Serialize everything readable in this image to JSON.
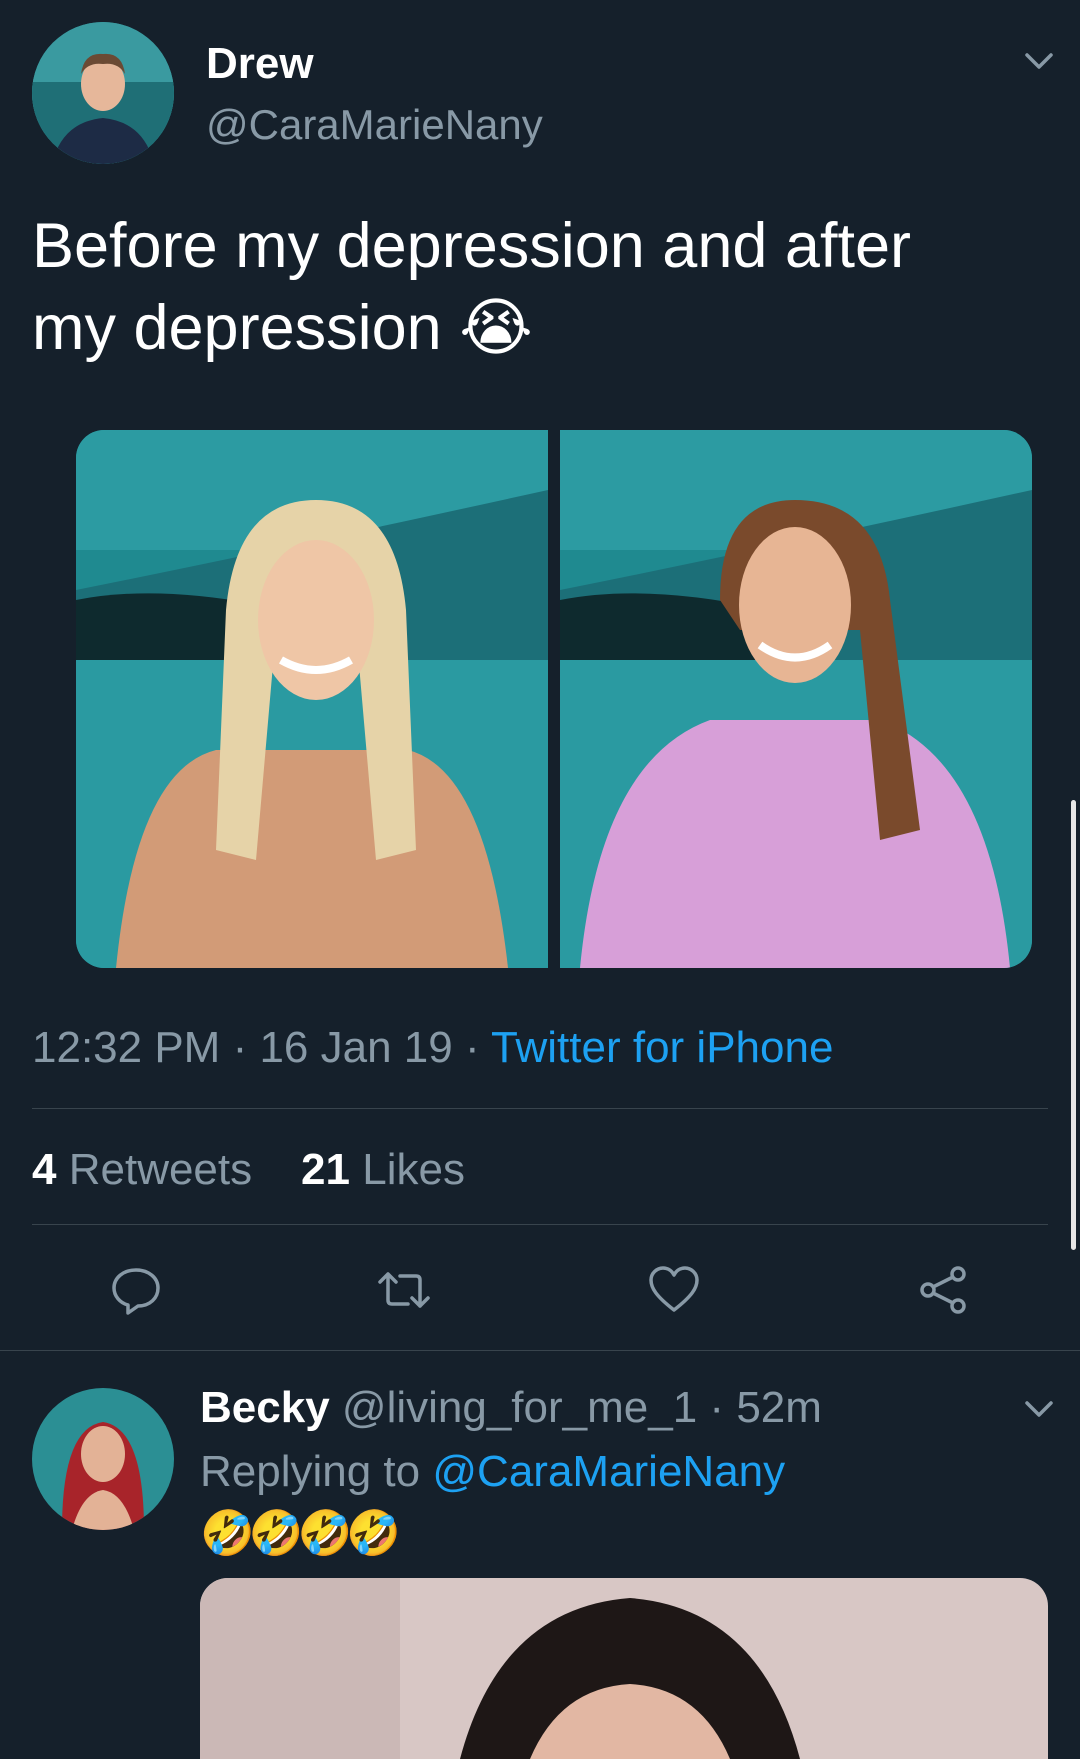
{
  "tweet": {
    "author_name": "Drew",
    "author_handle": "@CaraMarieNany",
    "text_line1": "Before my depression and after",
    "text_line2": "my depression",
    "emoji": "😭",
    "time": "12:32 PM",
    "sep1": " · ",
    "date": "16 Jan 19",
    "sep2": " · ",
    "source": "Twitter for iPhone",
    "retweets_count": "4",
    "retweets_label": "Retweets",
    "likes_count": "21",
    "likes_label": "Likes",
    "icons": [
      "reply-icon",
      "retweet-icon",
      "like-icon",
      "share-icon"
    ]
  },
  "reply": {
    "author_name": "Becky",
    "author_handle": "@living_for_me_1",
    "sep": " · ",
    "age": "52m",
    "replying_label": "Replying to",
    "replying_handle": "@CaraMarieNany",
    "emojis": "🤣🤣🤣🤣"
  },
  "colors": {
    "background": "#15202b",
    "muted": "#8899a6",
    "link": "#1da1f2",
    "divider": "#38444d"
  }
}
